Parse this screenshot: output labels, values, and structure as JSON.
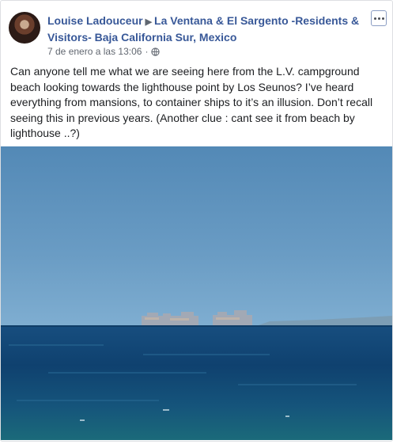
{
  "post": {
    "author": "Louise Ladouceur",
    "group": "La Ventana & El Sargento -Residents & Visitors- Baja California Sur, Mexico",
    "timestamp": "7 de enero a las 13:06",
    "separator": "·",
    "privacy_icon": "globe-icon",
    "body": "Can anyone tell me what we are seeing here from the L.V. campground beach looking towards the lighthouse point by Los Seunos? I’ve heard everything from mansions, to container ships to it’s an illusion. Don’t recall seeing this in previous years. (Another clue : cant see it from beach by lighthouse ..?)",
    "menu_icon": "more-options-icon"
  },
  "colors": {
    "link": "#385898",
    "sky": "#5c91be",
    "sea": "#124b7c"
  }
}
